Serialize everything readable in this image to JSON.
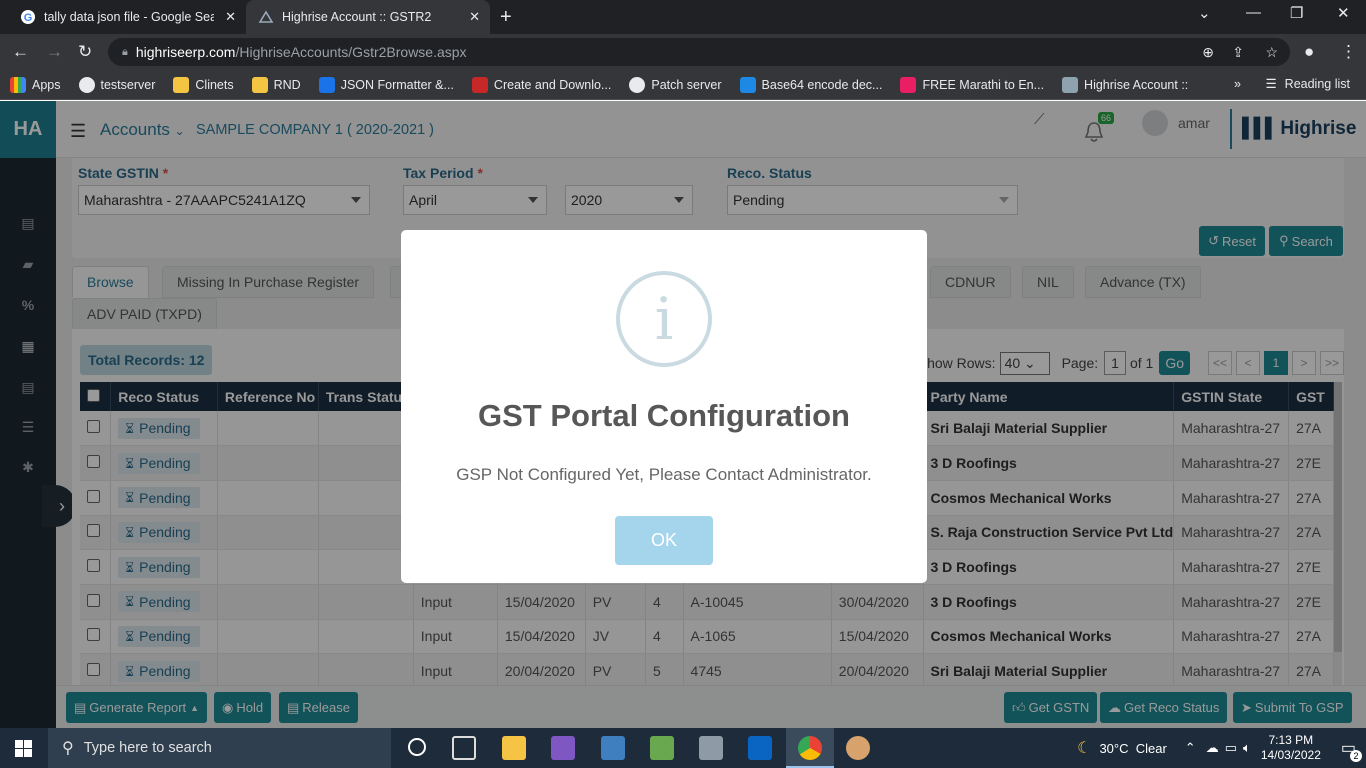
{
  "browser": {
    "tabs": [
      {
        "title": "tally data json file - Google Search",
        "active": false
      },
      {
        "title": "Highrise Account :: GSTR2",
        "active": true
      }
    ],
    "url_host": "highriseerp.com",
    "url_path": "/HighriseAccounts/Gstr2Browse.aspx",
    "bookmarks": [
      "Apps",
      "testserver",
      "Clinets",
      "RND",
      "JSON Formatter &...",
      "Create and Downlo...",
      "Patch server",
      "Base64 encode dec...",
      "FREE Marathi to En...",
      "Highrise Account ::"
    ],
    "reading_list": "Reading list"
  },
  "app": {
    "logo": "HA",
    "module": "Accounts",
    "company": "SAMPLE COMPANY 1 ( 2020-2021 )",
    "notification_count": "66",
    "user": "amar",
    "brand": "Highrise"
  },
  "filters": {
    "state_label": "State GSTIN",
    "state_value": "Maharashtra - 27AAAPC5241A1ZQ",
    "tax_period_label": "Tax Period",
    "month_value": "April",
    "year_value": "2020",
    "reco_label": "Reco. Status",
    "reco_value": "Pending",
    "reset": "Reset",
    "search": "Search"
  },
  "tabs": [
    "Browse",
    "Missing In Purchase Register",
    "CDNUR",
    "NIL",
    "Advance (TX)",
    "ADV PAID (TXPD)"
  ],
  "grid": {
    "total_records": "Total Records: 12",
    "show_rows_label": "Show Rows:",
    "show_rows_value": "40",
    "page_label": "Page:",
    "page_value": "1",
    "page_of": "of 1",
    "go": "Go",
    "pager": [
      "<<",
      "<",
      "1",
      ">",
      ">>"
    ],
    "columns": [
      "Reco Status",
      "Reference No",
      "Trans Status",
      "",
      "",
      "",
      "",
      "",
      "",
      "Party Name",
      "GSTIN State",
      "GST"
    ],
    "rows": [
      {
        "status": "Pending",
        "ref": "",
        "trans": "",
        "type": "",
        "date": "",
        "vt": "",
        "no": "",
        "inv": "",
        "invdate": "",
        "party": "Sri Balaji Material Supplier",
        "state": "Maharashtra-27",
        "gst": "27A"
      },
      {
        "status": "Pending",
        "ref": "",
        "trans": "",
        "type": "",
        "date": "",
        "vt": "",
        "no": "",
        "inv": "",
        "invdate": "",
        "party": "3 D Roofings",
        "state": "Maharashtra-27",
        "gst": "27E"
      },
      {
        "status": "Pending",
        "ref": "",
        "trans": "",
        "type": "",
        "date": "",
        "vt": "",
        "no": "",
        "inv": "",
        "invdate": "",
        "party": "Cosmos Mechanical Works",
        "state": "Maharashtra-27",
        "gst": "27A"
      },
      {
        "status": "Pending",
        "ref": "",
        "trans": "",
        "type": "",
        "date": "",
        "vt": "",
        "no": "",
        "inv": "",
        "invdate": "",
        "party": "S. Raja Construction Service Pvt Ltd",
        "state": "Maharashtra-27",
        "gst": "27A"
      },
      {
        "status": "Pending",
        "ref": "",
        "trans": "",
        "type": "",
        "date": "",
        "vt": "",
        "no": "",
        "inv": "",
        "invdate": "",
        "party": "3 D Roofings",
        "state": "Maharashtra-27",
        "gst": "27E"
      },
      {
        "status": "Pending",
        "ref": "",
        "trans": "",
        "type": "Input",
        "date": "15/04/2020",
        "vt": "PV",
        "no": "4",
        "inv": "A-10045",
        "invdate": "30/04/2020",
        "party": "3 D Roofings",
        "state": "Maharashtra-27",
        "gst": "27E"
      },
      {
        "status": "Pending",
        "ref": "",
        "trans": "",
        "type": "Input",
        "date": "15/04/2020",
        "vt": "JV",
        "no": "4",
        "inv": "A-1065",
        "invdate": "15/04/2020",
        "party": "Cosmos Mechanical Works",
        "state": "Maharashtra-27",
        "gst": "27A"
      },
      {
        "status": "Pending",
        "ref": "",
        "trans": "",
        "type": "Input",
        "date": "20/04/2020",
        "vt": "PV",
        "no": "5",
        "inv": "4745",
        "invdate": "20/04/2020",
        "party": "Sri Balaji Material Supplier",
        "state": "Maharashtra-27",
        "gst": "27A"
      }
    ]
  },
  "bottom": {
    "generate_report": "Generate Report",
    "hold": "Hold",
    "release": "Release",
    "get_gstn": "Get GSTN",
    "get_reco_status": "Get Reco Status",
    "submit_to_gsp": "Submit To GSP"
  },
  "modal": {
    "title": "GST Portal Configuration",
    "message": "GSP Not Configured Yet, Please Contact Administrator.",
    "ok": "OK"
  },
  "taskbar": {
    "search_placeholder": "Type here to search",
    "weather": "30°C  Clear",
    "time": "7:13 PM",
    "date": "14/03/2022",
    "notification_count": "2"
  },
  "colors": {
    "accent": "#1f8a96",
    "header_dark": "#1c2f44",
    "ok_button": "#a5d5ec"
  }
}
